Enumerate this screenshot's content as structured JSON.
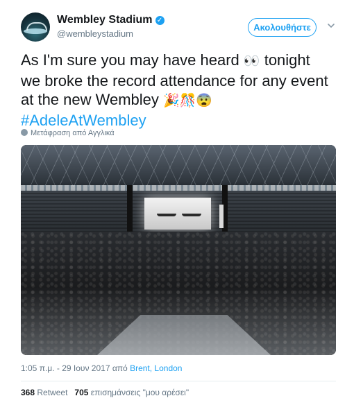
{
  "header": {
    "display_name": "Wembley Stadium",
    "handle": "@wembleystadium",
    "follow_label": "Ακολουθήστε",
    "verified_glyph": "✓"
  },
  "tweet": {
    "line1": "As I'm sure you may have heard",
    "line1_emoji": "👀",
    "line1_tail": " tonight",
    "line2": "we broke the record attendance for any event",
    "line3": "at the new Wembley",
    "line3_emoji": "🎉🎊😨",
    "hashtag": "#AdeleAtWembley",
    "translate_label": "Μετάφραση από Αγγλικά"
  },
  "meta": {
    "time": "1:05 π.μ. - 29 Ιουν 2017 από",
    "place": "Brent, London"
  },
  "stats": {
    "retweets": "368",
    "retweets_label": "Retweet",
    "likes": "705",
    "likes_label": "επισημάνσεις \"μου αρέσει\""
  },
  "colors": {
    "accent": "#1da1f2",
    "text": "#14171a",
    "muted": "#657786"
  },
  "icons": {
    "avatar": "stadium-avatar",
    "verified": "verified-badge-icon",
    "more": "chevron-down-icon",
    "translate": "globe-icon"
  }
}
